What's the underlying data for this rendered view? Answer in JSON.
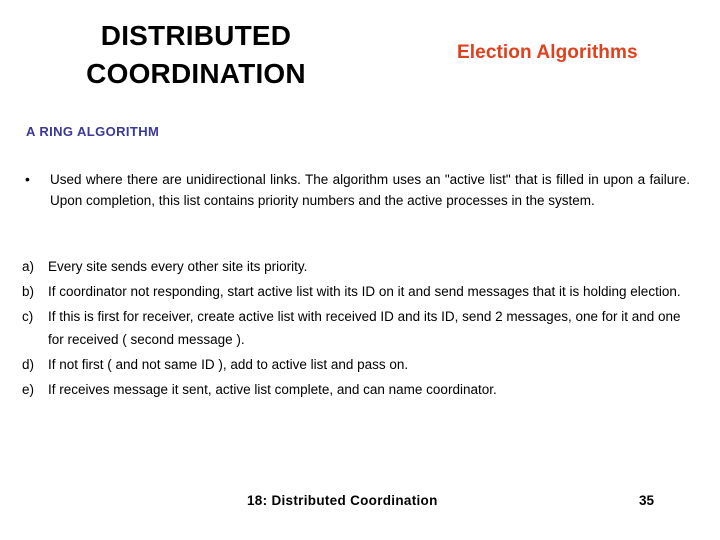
{
  "slide": {
    "background_color": "#ffffff",
    "title_lines": [
      "DISTRIBUTED",
      "COORDINATION"
    ],
    "title_color": "#000000",
    "topic_label": "Election Algorithms",
    "topic_color": "#e0411d",
    "section_heading": "A RING ALGORITHM",
    "section_heading_color": "#39389b"
  },
  "intro": {
    "bullet_marker": "•",
    "text": "Used where there are unidirectional links. The algorithm uses an \"active list\" that is filled in upon a failure. Upon completion, this list contains priority numbers and the active processes in the system."
  },
  "steps": [
    {
      "marker": "a)",
      "text": "Every site sends every other site its priority."
    },
    {
      "marker": "b)",
      "text": "If coordinator not responding, start active list with its ID on it and send messages that it is holding election."
    },
    {
      "marker": "c)",
      "text": "If this is first for receiver, create active list with received ID and its ID, send 2 messages, one for it and one for received ( second message )."
    },
    {
      "marker": "d)",
      "text": "If not first ( and not same ID ), add to active list and pass on."
    },
    {
      "marker": "e)",
      "text": "If receives message it sent, active list complete, and can name coordinator."
    }
  ],
  "footer": {
    "title": "18: Distributed Coordination",
    "page_number": "35"
  }
}
